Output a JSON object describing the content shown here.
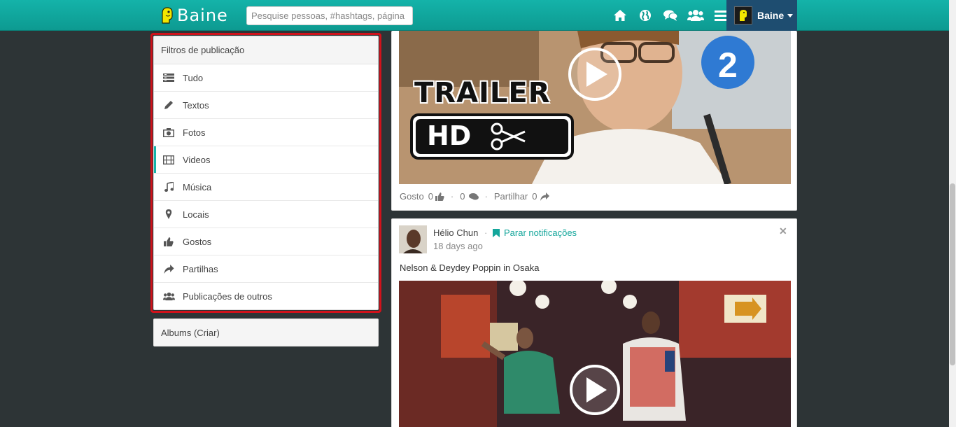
{
  "header": {
    "brand": "Baine",
    "search": {
      "placeholder": "Pesquise pessoas, #hashtags, página",
      "value": ""
    },
    "nav_icons": [
      "home-icon",
      "globe-icon",
      "comments-icon",
      "users-icon",
      "menu-icon"
    ],
    "user": {
      "name": "Baine"
    },
    "accent_color": "#14b3a9"
  },
  "sidebar": {
    "filters_title": "Filtros de publicação",
    "filters": [
      {
        "label": "Tudo",
        "icon": "list-icon",
        "active": false
      },
      {
        "label": "Textos",
        "icon": "pencil-icon",
        "active": false
      },
      {
        "label": "Fotos",
        "icon": "camera-icon",
        "active": false
      },
      {
        "label": "Videos",
        "icon": "film-icon",
        "active": true
      },
      {
        "label": "Música",
        "icon": "music-icon",
        "active": false
      },
      {
        "label": "Locais",
        "icon": "map-marker-icon",
        "active": false
      },
      {
        "label": "Gostos",
        "icon": "thumbs-up-icon",
        "active": false
      },
      {
        "label": "Partilhas",
        "icon": "share-icon",
        "active": false
      },
      {
        "label": "Publicações de outros",
        "icon": "users-icon",
        "active": false
      }
    ],
    "albums_title": "Albums (Criar)"
  },
  "feed": {
    "post1": {
      "video_overlay": {
        "line1": "TRAILER",
        "line2": "HD"
      },
      "actions": {
        "like_label": "Gosto",
        "like_count": "0",
        "comment_count": "0",
        "share_label": "Partilhar",
        "share_count": "0"
      }
    },
    "post2": {
      "author": "Hélio Chun",
      "stop_notifications": "Parar notificações",
      "time": "18 days ago",
      "text": "Nelson & Deydey Poppin in Osaka"
    }
  }
}
